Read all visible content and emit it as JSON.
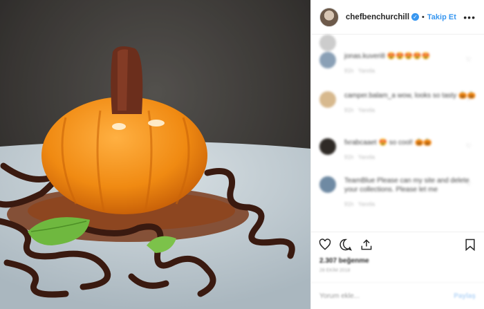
{
  "post": {
    "username": "chefbenchurchill",
    "verified_symbol": "✓",
    "separator": "•",
    "follow_label": "Takip Et",
    "more_label": "•••"
  },
  "comments": [
    {
      "text": "jonas.kuveri8 😍😍😍😍😍",
      "time": "91h",
      "reply": "Yanıtla",
      "avatar_color": "#8aa0b6"
    },
    {
      "text": "camper.balam_a wow, looks so tasty 🎃🎃",
      "time": "91h",
      "reply": "Yanıtla",
      "avatar_color": "#d7b98e"
    },
    {
      "text": "fxrabcaaet 😍 so cool! 🎃🎃",
      "time": "91h",
      "reply": "Yanıtla",
      "avatar_color": "#2f2a26"
    },
    {
      "text": "TeamBlue Please can my site and delete your collections. Please let me",
      "time": "91h",
      "reply": "Yanıtla",
      "avatar_color": "#6f8aa3"
    }
  ],
  "engagement": {
    "likes": "2.307 beğenme",
    "date": "28 EKİM 2018"
  },
  "add_comment": {
    "placeholder": "Yorum ekle...",
    "post_label": "Paylaş"
  },
  "icons": [
    "heart-icon",
    "comment-icon",
    "share-icon",
    "bookmark-icon",
    "more-icon",
    "verified-icon"
  ],
  "colors": {
    "accent": "#3897f0",
    "text": "#262626",
    "muted": "#999999",
    "border": "#efefef"
  }
}
